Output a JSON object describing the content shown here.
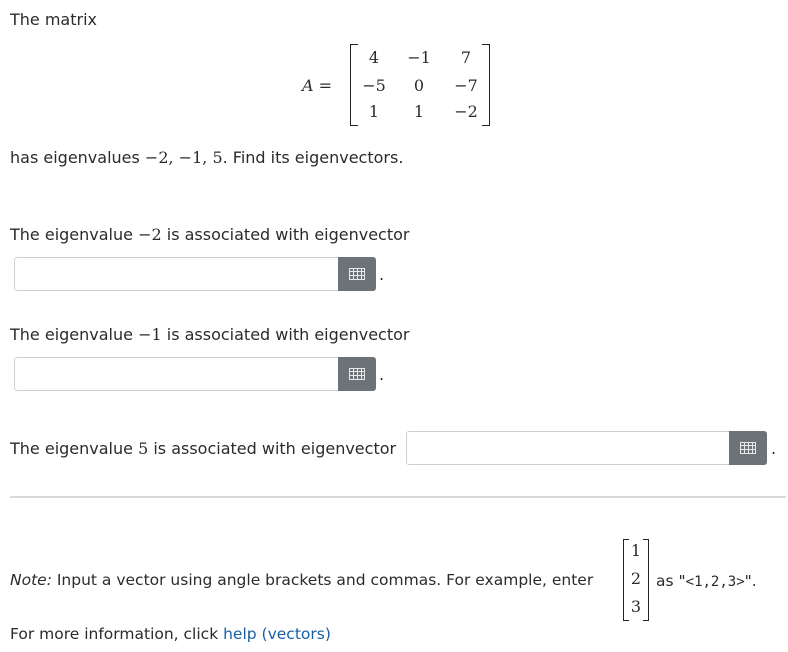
{
  "intro": {
    "line1": "The matrix",
    "matrix_label": "A =",
    "matrix": [
      [
        "4",
        "−1",
        "7"
      ],
      [
        "−5",
        "0",
        "−7"
      ],
      [
        "1",
        "1",
        "−2"
      ]
    ],
    "eigen_text_pre": "has eigenvalues ",
    "eigen_values_math": "−2, −1, 5",
    "eigen_text_post": ". Find its eigenvectors."
  },
  "questions": [
    {
      "pre": "The eigenvalue ",
      "value": "−2",
      "post": " is associated with eigenvector",
      "answer": ""
    },
    {
      "pre": "The eigenvalue ",
      "value": "−1",
      "post": " is associated with eigenvector",
      "answer": ""
    },
    {
      "pre": "The eigenvalue ",
      "value": "5",
      "post": " is associated with eigenvector",
      "answer": ""
    }
  ],
  "punct": ".",
  "note": {
    "label": "Note:",
    "text": " Input a vector using angle brackets and commas. For example, enter ",
    "example_vector": [
      "1",
      "2",
      "3"
    ],
    "as_text": " as \"",
    "code": "<1,2,3>",
    "end": "\"."
  },
  "help": {
    "pre": "For more information, click ",
    "link": "help (vectors)"
  },
  "icons": {
    "keyboard": "keyboard-grid-icon"
  },
  "colors": {
    "button": "#6c7378",
    "link": "#1a5ea8"
  }
}
